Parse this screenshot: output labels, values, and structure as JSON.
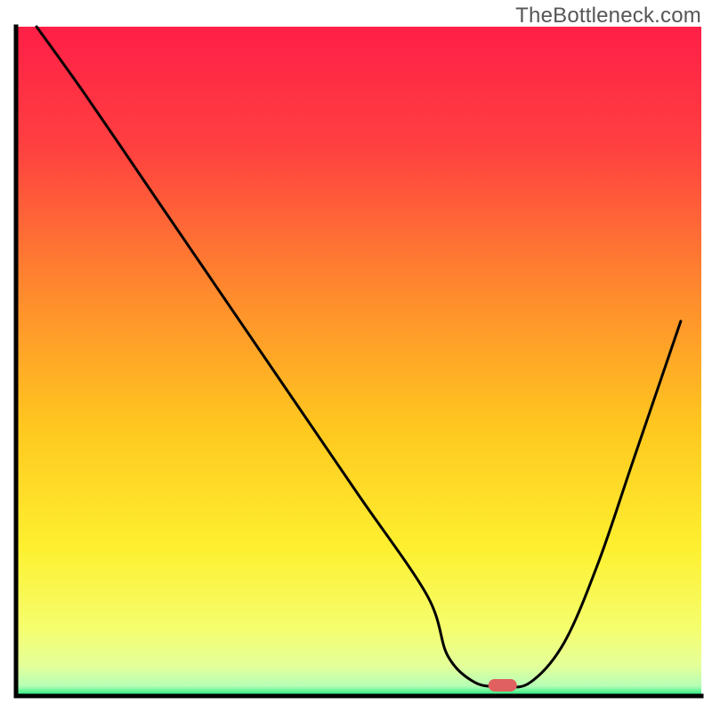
{
  "watermark": "TheBottleneck.com",
  "chart_data": {
    "type": "line",
    "title": "",
    "xlabel": "",
    "ylabel": "",
    "xlim": [
      0,
      100
    ],
    "ylim": [
      0,
      100
    ],
    "grid": false,
    "legend": false,
    "series": [
      {
        "name": "bottleneck-curve",
        "x": [
          3,
          10,
          20,
          26,
          30,
          40,
          50,
          60,
          63,
          67,
          71,
          75,
          80,
          85,
          90,
          97
        ],
        "y": [
          100,
          90,
          75,
          66,
          60,
          45,
          30,
          15,
          6,
          2,
          1.5,
          2,
          8,
          20,
          35,
          56
        ]
      }
    ],
    "marker": {
      "name": "optimal-point",
      "x": 71,
      "y": 1.6,
      "color": "#e06060",
      "shape": "rounded-rect"
    },
    "background_gradient": {
      "stops": [
        {
          "offset": 0,
          "color": "#ff1f47"
        },
        {
          "offset": 0.18,
          "color": "#ff4040"
        },
        {
          "offset": 0.4,
          "color": "#ff8b2d"
        },
        {
          "offset": 0.6,
          "color": "#ffc81f"
        },
        {
          "offset": 0.78,
          "color": "#fdf030"
        },
        {
          "offset": 0.9,
          "color": "#f5fe6e"
        },
        {
          "offset": 0.955,
          "color": "#e4ff9a"
        },
        {
          "offset": 0.985,
          "color": "#b6ffb6"
        },
        {
          "offset": 1.0,
          "color": "#17e879"
        }
      ]
    },
    "axis_color": "#000000",
    "axis_width": 5,
    "line_color": "#000000",
    "line_width": 3
  }
}
